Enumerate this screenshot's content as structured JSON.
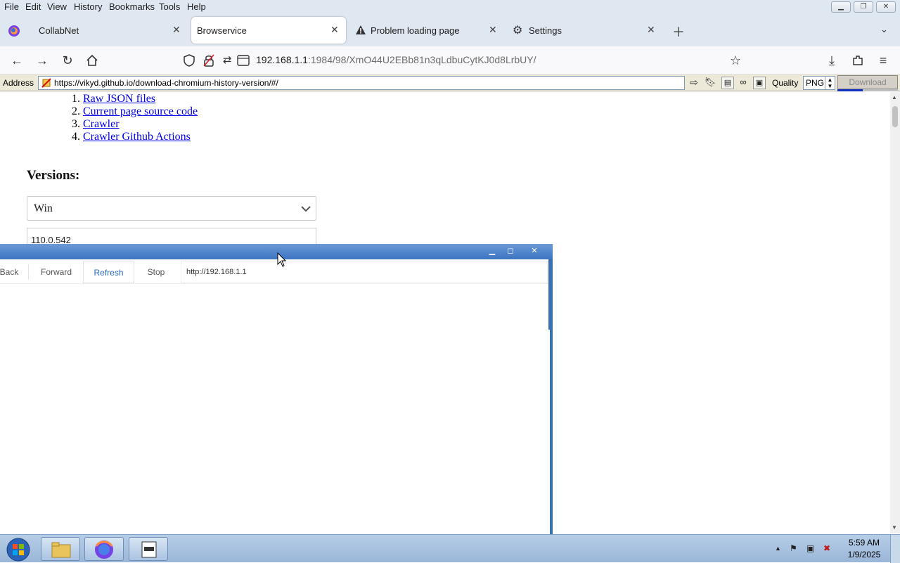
{
  "menubar": {
    "items": [
      "File",
      "Edit",
      "View",
      "History",
      "Bookmarks",
      "Tools",
      "Help"
    ]
  },
  "tabs": [
    {
      "label": "CollabNet",
      "active": false
    },
    {
      "label": "Browservice",
      "active": true
    },
    {
      "label": "Problem loading page",
      "active": false
    },
    {
      "label": "Settings",
      "active": false
    }
  ],
  "navbar": {
    "url_host": "192.168.1.1",
    "url_rest": ":1984/98/XmO44U2EBb81n3qLdbuCytKJ0d8LrbUY/"
  },
  "addressbar": {
    "label": "Address",
    "value": "https://vikyd.github.io/download-chromium-history-version/#/",
    "quality_label": "Quality",
    "quality_value": "PNG",
    "download_label": "Download",
    "download_progress": 0.42
  },
  "content": {
    "links": [
      {
        "num": "1.",
        "text": "Raw JSON files"
      },
      {
        "num": "2.",
        "text": "Current page source code"
      },
      {
        "num": "3.",
        "text": "Crawler"
      },
      {
        "num": "4.",
        "text": "Crawler Github Actions"
      }
    ],
    "versions_heading": "Versions:",
    "platform_value": "Win",
    "version_value": "110.0.542"
  },
  "float_window": {
    "nav": {
      "back": "Back",
      "forward": "Forward",
      "refresh": "Refresh",
      "stop": "Stop"
    },
    "url": "http://192.168.1.1"
  },
  "taskbar": {
    "time": "5:59 AM",
    "date": "1/9/2025"
  }
}
